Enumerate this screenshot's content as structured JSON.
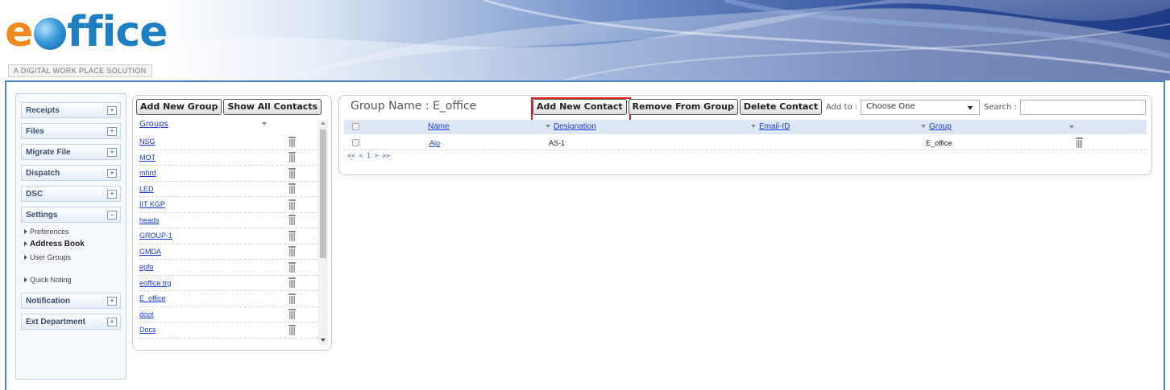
{
  "header": {
    "logo_e": "e",
    "logo_rest": "ffice",
    "tagline": "A DIGITAL WORK PLACE SOLUTION"
  },
  "nav": {
    "receipts": "Receipts",
    "files": "Files",
    "migrate_file": "Migrate File",
    "dispatch": "Dispatch",
    "dsc": "DSC",
    "settings": "Settings",
    "preferences": "Preferences",
    "address_book": "Address Book",
    "user_groups": "User Groups",
    "quick_noting": "Quick Noting",
    "notification": "Notification",
    "ext_department": "Ext Department",
    "expand_symbol": "+",
    "collapse_symbol": "−"
  },
  "groups_panel": {
    "add_new_group": "Add New Group",
    "show_all_contacts": "Show All Contacts",
    "groups_header": "Groups",
    "groups": [
      "NSG",
      "MOT",
      "mhrd",
      "LED",
      "IIT KGP",
      "heads",
      "GROUP-1",
      "GMDA",
      "epfo",
      "eoffice trg",
      "E_office",
      "doot",
      "Docs"
    ]
  },
  "contacts_panel": {
    "group_name_label": "Group Name : E_office",
    "add_new_contact": "Add New Contact",
    "remove_from_group": "Remove From Group",
    "delete_contact": "Delete Contact",
    "add_to_label": "Add to :",
    "add_to_value": "Choose One",
    "search_label": "Search :",
    "search_value": "",
    "columns": {
      "name": "Name",
      "designation": "Designation",
      "email": "Email-ID",
      "group": "Group"
    },
    "rows": [
      {
        "name": "Ajo",
        "designation": "AS-1",
        "email": "",
        "group": "E_office"
      }
    ],
    "pager": "<< < 1 > >>"
  },
  "colors": {
    "frame_border": "#4f87c5",
    "link": "#1a3bd6",
    "highlight": "#e02020",
    "logo_orange": "#f08a1c",
    "logo_blue": "#1d7fc2"
  }
}
